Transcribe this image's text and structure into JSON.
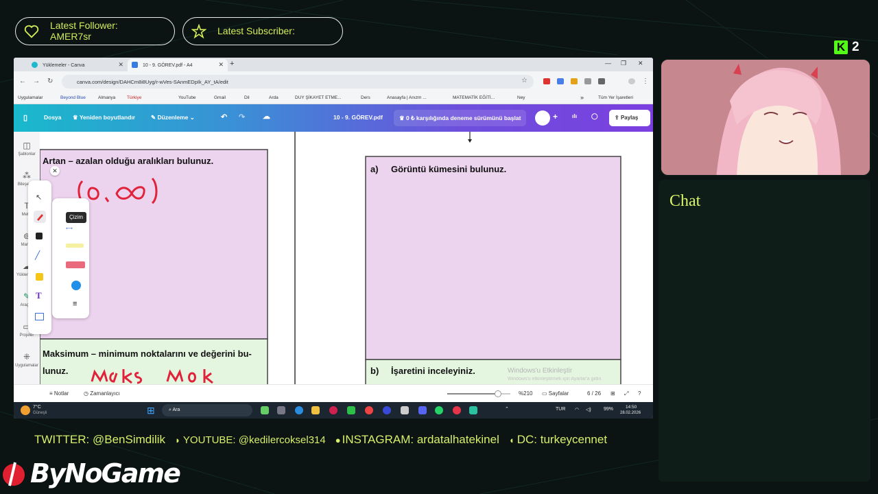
{
  "overlay": {
    "latest_follower_label": "Latest Follower:",
    "latest_follower_name": "AMER7sr",
    "latest_subscriber_label": "Latest Subscriber:",
    "latest_subscriber_name": "",
    "kick_viewer_count": "2",
    "chat_title": "Chat",
    "socials": {
      "twitter": "TWITTER: @BenSimdilik",
      "youtube": "YOUTUBE: @kedilercoksel314",
      "instagram": "INSTAGRAM: ardatalhatekinel",
      "discord": "DC: turkeycennet"
    },
    "brand": "ByNoGame",
    "accent_color": "#d4ec5a"
  },
  "browser": {
    "tabs": [
      {
        "label": "Yüklemeler - Canva",
        "active": false
      },
      {
        "label": "10 - 9. GÖREV.pdf - A4",
        "active": true
      }
    ],
    "new_tab_label": "+",
    "url": "canva.com/design/DAHCm8i8Uyg/r-wVes-SAnmEDpIk_AY_tA/edit",
    "bookmarks": [
      "Uygulamalar",
      "Beyond Blue",
      "Almanya",
      "Türkiye",
      "YouTube",
      "Gmail",
      "Dil",
      "Arda",
      "DUY ŞİKAYET ETME...",
      "Ders",
      "Anasayfa | Anızm ...",
      "MATEMATİK EĞİTİ...",
      "Ney"
    ],
    "bookmarks_more": "»",
    "all_bookmarks": "Tüm Yer İşaretleri"
  },
  "canva": {
    "file_menu": "Dosya",
    "resize": "Yeniden boyutlandır",
    "editing": "Düzenleme",
    "doc_title": "10 - 9. GÖREV.pdf",
    "trial": "0 ₺ karşılığında deneme sürümünü başlat",
    "share": "Paylaş",
    "rail": [
      "Şablonlar",
      "Bileşenler",
      "Metin",
      "Marka",
      "Yüklemeler",
      "Araçlar",
      "Projeler",
      "Uygulamalar"
    ],
    "tool_tooltip": "Çizim",
    "page_content": {
      "left_q1": "Artan – azalan olduğu aralıkları bulunuz.",
      "left_handwriting": "(0,∞)",
      "left_q2": "Maksimum – minimum noktalarını ve değerini bulunuz.",
      "left_q2_line1": "Maksimum – minimum noktalarını ve değerini bu-",
      "left_q2_line2": "lunuz.",
      "left_handwriting2": "maks mok",
      "right_q1_letter": "a)",
      "right_q1": "Görüntü kümesini bulunuz.",
      "right_q2_letter": "b)",
      "right_q2": "İşaretini inceleyiniz.",
      "watermark": "Windows'u Etkinleştir",
      "watermark_sub": "Windows'u etkinleştirmek için Ayarlar'a gidin."
    },
    "bottom": {
      "notes": "Notlar",
      "timer": "Zamanlayıcı",
      "zoom": "%210",
      "pages": "Sayfalar",
      "page_count": "6 / 26",
      "zoom_fraction": 0.8
    }
  },
  "taskbar": {
    "weather_temp": "7°C",
    "weather_label": "Güneşli",
    "search": "Ara",
    "lang": "TUR",
    "battery": "99%",
    "time": "14:50",
    "date": "28.02.2026"
  }
}
